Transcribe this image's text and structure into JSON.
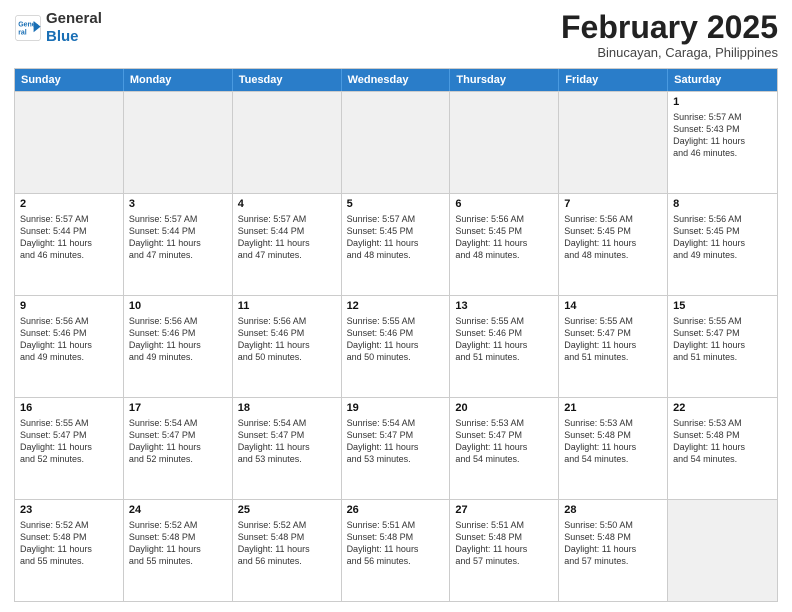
{
  "header": {
    "logo_line1": "General",
    "logo_line2": "Blue",
    "month_title": "February 2025",
    "location": "Binucayan, Caraga, Philippines"
  },
  "days_of_week": [
    "Sunday",
    "Monday",
    "Tuesday",
    "Wednesday",
    "Thursday",
    "Friday",
    "Saturday"
  ],
  "weeks": [
    [
      {
        "day": "",
        "info": "",
        "shaded": true
      },
      {
        "day": "",
        "info": "",
        "shaded": true
      },
      {
        "day": "",
        "info": "",
        "shaded": true
      },
      {
        "day": "",
        "info": "",
        "shaded": true
      },
      {
        "day": "",
        "info": "",
        "shaded": true
      },
      {
        "day": "",
        "info": "",
        "shaded": true
      },
      {
        "day": "1",
        "info": "Sunrise: 5:57 AM\nSunset: 5:43 PM\nDaylight: 11 hours\nand 46 minutes.",
        "shaded": false
      }
    ],
    [
      {
        "day": "2",
        "info": "Sunrise: 5:57 AM\nSunset: 5:44 PM\nDaylight: 11 hours\nand 46 minutes.",
        "shaded": false
      },
      {
        "day": "3",
        "info": "Sunrise: 5:57 AM\nSunset: 5:44 PM\nDaylight: 11 hours\nand 47 minutes.",
        "shaded": false
      },
      {
        "day": "4",
        "info": "Sunrise: 5:57 AM\nSunset: 5:44 PM\nDaylight: 11 hours\nand 47 minutes.",
        "shaded": false
      },
      {
        "day": "5",
        "info": "Sunrise: 5:57 AM\nSunset: 5:45 PM\nDaylight: 11 hours\nand 48 minutes.",
        "shaded": false
      },
      {
        "day": "6",
        "info": "Sunrise: 5:56 AM\nSunset: 5:45 PM\nDaylight: 11 hours\nand 48 minutes.",
        "shaded": false
      },
      {
        "day": "7",
        "info": "Sunrise: 5:56 AM\nSunset: 5:45 PM\nDaylight: 11 hours\nand 48 minutes.",
        "shaded": false
      },
      {
        "day": "8",
        "info": "Sunrise: 5:56 AM\nSunset: 5:45 PM\nDaylight: 11 hours\nand 49 minutes.",
        "shaded": false
      }
    ],
    [
      {
        "day": "9",
        "info": "Sunrise: 5:56 AM\nSunset: 5:46 PM\nDaylight: 11 hours\nand 49 minutes.",
        "shaded": false
      },
      {
        "day": "10",
        "info": "Sunrise: 5:56 AM\nSunset: 5:46 PM\nDaylight: 11 hours\nand 49 minutes.",
        "shaded": false
      },
      {
        "day": "11",
        "info": "Sunrise: 5:56 AM\nSunset: 5:46 PM\nDaylight: 11 hours\nand 50 minutes.",
        "shaded": false
      },
      {
        "day": "12",
        "info": "Sunrise: 5:55 AM\nSunset: 5:46 PM\nDaylight: 11 hours\nand 50 minutes.",
        "shaded": false
      },
      {
        "day": "13",
        "info": "Sunrise: 5:55 AM\nSunset: 5:46 PM\nDaylight: 11 hours\nand 51 minutes.",
        "shaded": false
      },
      {
        "day": "14",
        "info": "Sunrise: 5:55 AM\nSunset: 5:47 PM\nDaylight: 11 hours\nand 51 minutes.",
        "shaded": false
      },
      {
        "day": "15",
        "info": "Sunrise: 5:55 AM\nSunset: 5:47 PM\nDaylight: 11 hours\nand 51 minutes.",
        "shaded": false
      }
    ],
    [
      {
        "day": "16",
        "info": "Sunrise: 5:55 AM\nSunset: 5:47 PM\nDaylight: 11 hours\nand 52 minutes.",
        "shaded": false
      },
      {
        "day": "17",
        "info": "Sunrise: 5:54 AM\nSunset: 5:47 PM\nDaylight: 11 hours\nand 52 minutes.",
        "shaded": false
      },
      {
        "day": "18",
        "info": "Sunrise: 5:54 AM\nSunset: 5:47 PM\nDaylight: 11 hours\nand 53 minutes.",
        "shaded": false
      },
      {
        "day": "19",
        "info": "Sunrise: 5:54 AM\nSunset: 5:47 PM\nDaylight: 11 hours\nand 53 minutes.",
        "shaded": false
      },
      {
        "day": "20",
        "info": "Sunrise: 5:53 AM\nSunset: 5:47 PM\nDaylight: 11 hours\nand 54 minutes.",
        "shaded": false
      },
      {
        "day": "21",
        "info": "Sunrise: 5:53 AM\nSunset: 5:48 PM\nDaylight: 11 hours\nand 54 minutes.",
        "shaded": false
      },
      {
        "day": "22",
        "info": "Sunrise: 5:53 AM\nSunset: 5:48 PM\nDaylight: 11 hours\nand 54 minutes.",
        "shaded": false
      }
    ],
    [
      {
        "day": "23",
        "info": "Sunrise: 5:52 AM\nSunset: 5:48 PM\nDaylight: 11 hours\nand 55 minutes.",
        "shaded": false
      },
      {
        "day": "24",
        "info": "Sunrise: 5:52 AM\nSunset: 5:48 PM\nDaylight: 11 hours\nand 55 minutes.",
        "shaded": false
      },
      {
        "day": "25",
        "info": "Sunrise: 5:52 AM\nSunset: 5:48 PM\nDaylight: 11 hours\nand 56 minutes.",
        "shaded": false
      },
      {
        "day": "26",
        "info": "Sunrise: 5:51 AM\nSunset: 5:48 PM\nDaylight: 11 hours\nand 56 minutes.",
        "shaded": false
      },
      {
        "day": "27",
        "info": "Sunrise: 5:51 AM\nSunset: 5:48 PM\nDaylight: 11 hours\nand 57 minutes.",
        "shaded": false
      },
      {
        "day": "28",
        "info": "Sunrise: 5:50 AM\nSunset: 5:48 PM\nDaylight: 11 hours\nand 57 minutes.",
        "shaded": false
      },
      {
        "day": "",
        "info": "",
        "shaded": true
      }
    ]
  ]
}
